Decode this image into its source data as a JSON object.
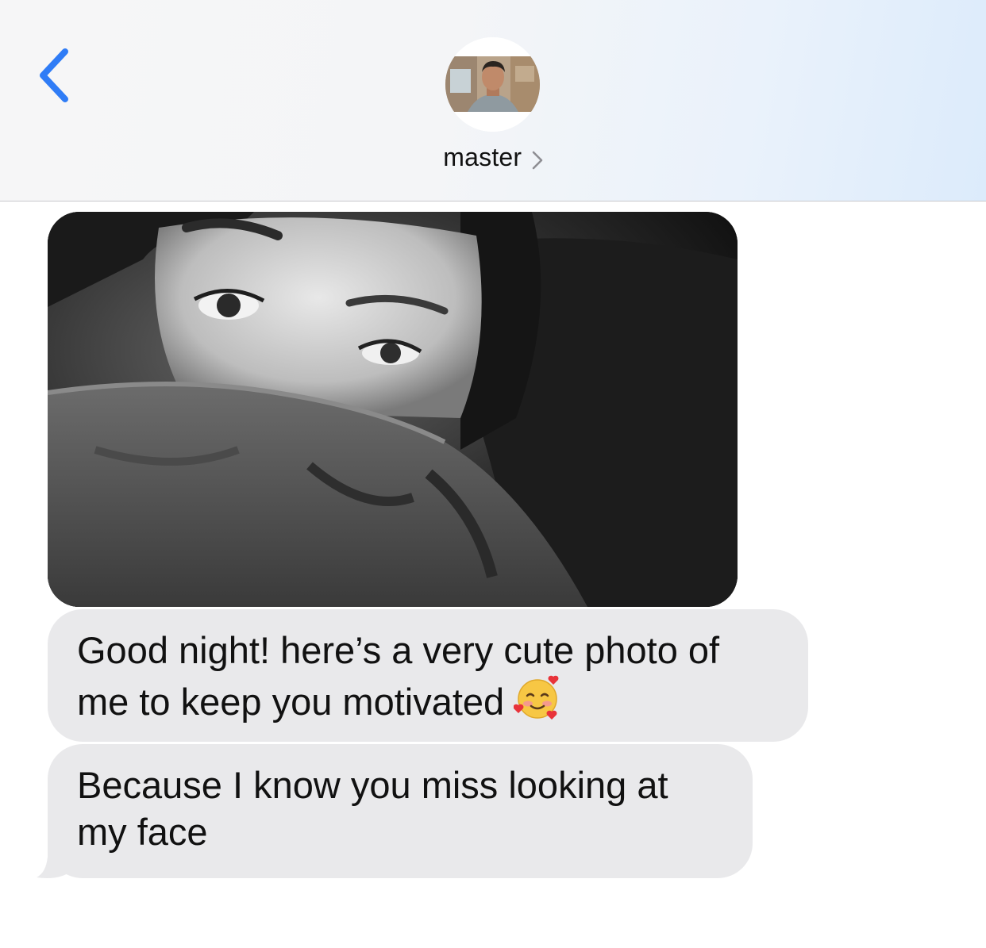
{
  "header": {
    "contact_name": "master",
    "back_icon": "chevron-left-icon",
    "name_icon": "chevron-right-icon",
    "accent_color": "#2f7cf6"
  },
  "conversation": {
    "photo": {
      "type": "received-photo",
      "tone": "black-and-white"
    },
    "messages": [
      {
        "text": "Good night! here’s a very cute photo of me to keep you motivated",
        "emoji": "smiling-face-with-hearts-icon"
      },
      {
        "text": "Because I know you miss looking at my face"
      }
    ],
    "bubble_color": "#e9e9eb"
  }
}
